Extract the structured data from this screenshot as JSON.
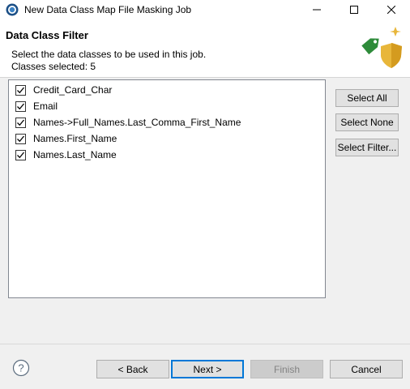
{
  "window": {
    "title": "New Data Class Map File Masking Job",
    "icons": {
      "app": "app-globe-icon",
      "minimize": "minimize-icon",
      "maximize": "maximize-icon",
      "close": "close-icon"
    }
  },
  "header": {
    "title": "Data Class Filter",
    "description": "Select the data classes to be used in this job.",
    "count_label": "Classes selected: 5",
    "art_icon": "tag-shield-icon"
  },
  "list": {
    "items": [
      {
        "label": "Credit_Card_Char",
        "checked": true
      },
      {
        "label": "Email",
        "checked": true
      },
      {
        "label": "Names->Full_Names.Last_Comma_First_Name",
        "checked": true
      },
      {
        "label": "Names.First_Name",
        "checked": true
      },
      {
        "label": "Names.Last_Name",
        "checked": true
      }
    ]
  },
  "side_buttons": {
    "select_all": "Select All",
    "select_none": "Select None",
    "select_filter": "Select Filter..."
  },
  "footer": {
    "help_icon": "help-icon",
    "back": "< Back",
    "next": "Next >",
    "finish": "Finish",
    "cancel": "Cancel"
  },
  "colors": {
    "accent": "#0078d7",
    "tag_green": "#2e8b3a",
    "shield_gold": "#e8b63a"
  }
}
